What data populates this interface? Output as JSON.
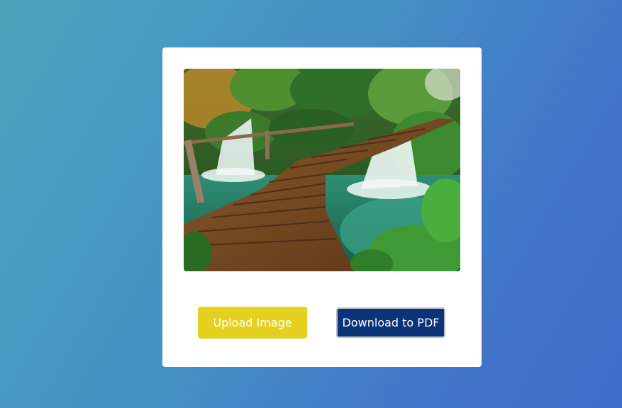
{
  "photo": {
    "subject": "forest waterfall with wooden boardwalk"
  },
  "buttons": {
    "upload_label": "Upload Image",
    "download_label": "Download to PDF"
  },
  "colors": {
    "upload_button": "#e5d01f",
    "download_button": "#0b3378",
    "card": "#ffffff",
    "background_start": "#4aa6bd",
    "background_end": "#3f6cca"
  }
}
